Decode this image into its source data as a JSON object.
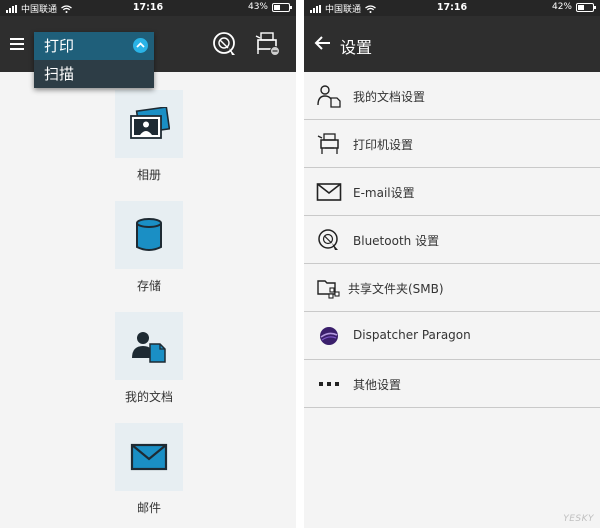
{
  "left_screen": {
    "status_bar": {
      "carrier": "中国联通",
      "time": "17:16",
      "battery_percent": "43%",
      "battery_level": 0.43
    },
    "mode_menu": {
      "selected": "打印",
      "options": [
        "打印",
        "扫描"
      ]
    },
    "appbar_icons": [
      "bluetooth-print-icon",
      "printer-icon"
    ],
    "tiles": [
      {
        "label": "相册",
        "icon": "photo-album-icon"
      },
      {
        "label": "存储",
        "icon": "storage-icon"
      },
      {
        "label": "我的文档",
        "icon": "my-documents-icon"
      },
      {
        "label": "邮件",
        "icon": "mail-icon"
      }
    ]
  },
  "right_screen": {
    "status_bar": {
      "carrier": "中国联通",
      "time": "17:16",
      "battery_percent": "42%",
      "battery_level": 0.42
    },
    "title": "设置",
    "settings": [
      {
        "label": "我的文档设置",
        "icon": "user-document-icon"
      },
      {
        "label": "打印机设置",
        "icon": "printer-icon"
      },
      {
        "label": "E-mail设置",
        "icon": "mail-icon"
      },
      {
        "label": "Bluetooth 设置",
        "icon": "bluetooth-print-icon"
      },
      {
        "label": "共享文件夹(SMB)",
        "icon": "shared-folder-icon"
      },
      {
        "label": "Dispatcher Paragon",
        "icon": "dispatcher-paragon-icon"
      },
      {
        "label": "其他设置",
        "icon": "more-icon"
      }
    ]
  },
  "watermark": "YESKY",
  "colors": {
    "appbar": "#2e2e2e",
    "status_bar": "#262626",
    "dropdown_selected": "#1f5f7a",
    "accent": "#2ab3e6",
    "tile_bg": "#e7eef2",
    "icon_blue": "#1a8fc5"
  }
}
